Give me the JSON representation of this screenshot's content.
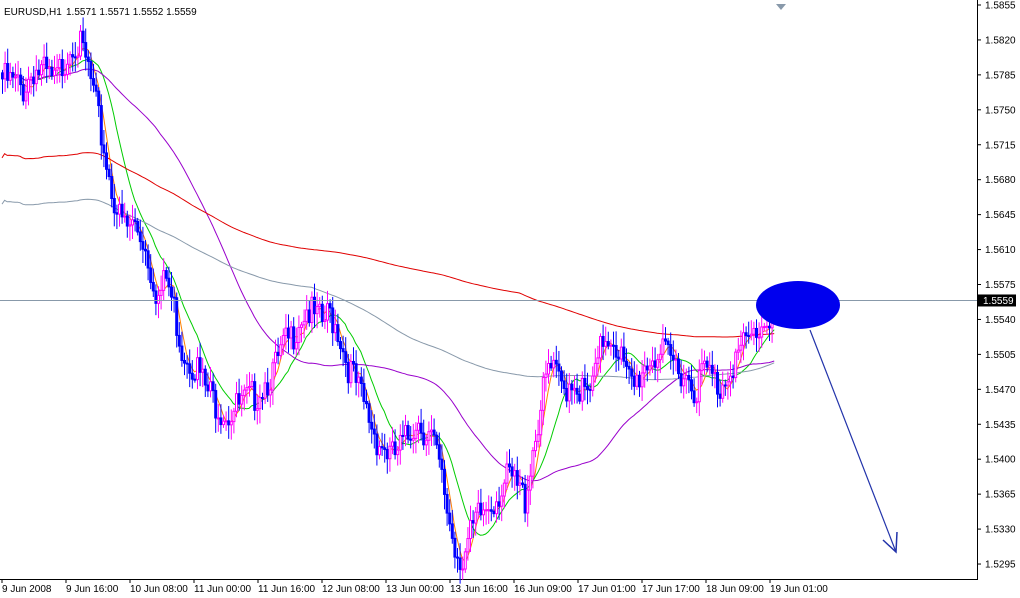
{
  "header": {
    "symbol_timeframe": "EURUSD,H1",
    "ohlc": "1.5571 1.5571 1.5552 1.5559"
  },
  "chart_data": {
    "type": "candlestick",
    "ylim": [
      1.528,
      1.586
    ],
    "y_ticks": [
      "1.5855",
      "1.5820",
      "1.5785",
      "1.5750",
      "1.5715",
      "1.5680",
      "1.5645",
      "1.5610",
      "1.5575",
      "1.5540",
      "1.5505",
      "1.5470",
      "1.5435",
      "1.5400",
      "1.5365",
      "1.5330",
      "1.5295"
    ],
    "x_ticks": [
      "9 Jun 2008",
      "9 Jun 16:00",
      "10 Jun 08:00",
      "11 Jun 00:00",
      "11 Jun 16:00",
      "12 Jun 08:00",
      "13 Jun 00:00",
      "13 Jun 16:00",
      "16 Jun 09:00",
      "17 Jun 01:00",
      "17 Jun 17:00",
      "18 Jun 09:00",
      "19 Jun 01:00"
    ],
    "current_price": "1.5559",
    "colors": {
      "bull": "#ff00ff",
      "bear": "#0000ff",
      "ma_fast": "#ff8000",
      "ma_mid": "#00cc00",
      "ma_slow": "#9900cc",
      "ma_200": "#e00000",
      "ma_gray": "#8899aa",
      "price_line": "#8899aa",
      "annotation": "#0000ee"
    },
    "grid": false,
    "annotations": [
      "blue-ellipse",
      "down-arrow"
    ],
    "close_path": [
      [
        0,
        1.579
      ],
      [
        4,
        1.5785
      ],
      [
        8,
        1.578
      ],
      [
        12,
        1.58
      ],
      [
        16,
        1.5795
      ],
      [
        20,
        1.5785
      ],
      [
        24,
        1.581
      ],
      [
        27,
        1.583
      ],
      [
        30,
        1.582
      ],
      [
        33,
        1.58
      ],
      [
        36,
        1.576
      ],
      [
        39,
        1.572
      ],
      [
        42,
        1.568
      ],
      [
        45,
        1.565
      ],
      [
        48,
        1.564
      ],
      [
        51,
        1.5645
      ],
      [
        54,
        1.563
      ],
      [
        57,
        1.56
      ],
      [
        60,
        1.557
      ],
      [
        63,
        1.559
      ],
      [
        66,
        1.556
      ],
      [
        69,
        1.552
      ],
      [
        72,
        1.551
      ],
      [
        75,
        1.55
      ],
      [
        78,
        1.548
      ],
      [
        81,
        1.547
      ],
      [
        84,
        1.546
      ],
      [
        87,
        1.5455
      ],
      [
        90,
        1.546
      ],
      [
        93,
        1.5465
      ],
      [
        96,
        1.547
      ],
      [
        99,
        1.548
      ],
      [
        102,
        1.549
      ],
      [
        105,
        1.55
      ],
      [
        108,
        1.552
      ],
      [
        111,
        1.553
      ],
      [
        114,
        1.555
      ],
      [
        117,
        1.556
      ],
      [
        120,
        1.555
      ],
      [
        123,
        1.5545
      ],
      [
        126,
        1.5555
      ],
      [
        129,
        1.554
      ],
      [
        132,
        1.551
      ],
      [
        135,
        1.549
      ],
      [
        138,
        1.547
      ],
      [
        141,
        1.545
      ],
      [
        144,
        1.543
      ],
      [
        147,
        1.542
      ],
      [
        150,
        1.541
      ],
      [
        153,
        1.542
      ],
      [
        156,
        1.543
      ],
      [
        159,
        1.545
      ],
      [
        162,
        1.544
      ],
      [
        165,
        1.543
      ],
      [
        168,
        1.54
      ],
      [
        171,
        1.536
      ],
      [
        174,
        1.532
      ],
      [
        177,
        1.531
      ],
      [
        180,
        1.533
      ],
      [
        183,
        1.535
      ],
      [
        186,
        1.536
      ],
      [
        189,
        1.537
      ],
      [
        192,
        1.538
      ],
      [
        195,
        1.539
      ],
      [
        198,
        1.538
      ],
      [
        201,
        1.537
      ],
      [
        204,
        1.542
      ],
      [
        207,
        1.546
      ],
      [
        210,
        1.55
      ],
      [
        213,
        1.549
      ],
      [
        216,
        1.548
      ],
      [
        219,
        1.549
      ],
      [
        222,
        1.548
      ],
      [
        225,
        1.547
      ],
      [
        228,
        1.549
      ],
      [
        231,
        1.553
      ],
      [
        234,
        1.5535
      ],
      [
        237,
        1.552
      ],
      [
        240,
        1.549
      ],
      [
        243,
        1.548
      ],
      [
        246,
        1.55
      ],
      [
        249,
        1.551
      ],
      [
        252,
        1.5515
      ],
      [
        255,
        1.551
      ],
      [
        258,
        1.5505
      ],
      [
        261,
        1.55
      ],
      [
        264,
        1.549
      ],
      [
        267,
        1.548
      ],
      [
        270,
        1.55
      ],
      [
        273,
        1.549
      ],
      [
        276,
        1.548
      ],
      [
        279,
        1.55
      ],
      [
        282,
        1.551
      ],
      [
        285,
        1.552
      ],
      [
        288,
        1.553
      ],
      [
        291,
        1.554
      ],
      [
        294,
        1.555
      ],
      [
        297,
        1.5559
      ]
    ]
  }
}
